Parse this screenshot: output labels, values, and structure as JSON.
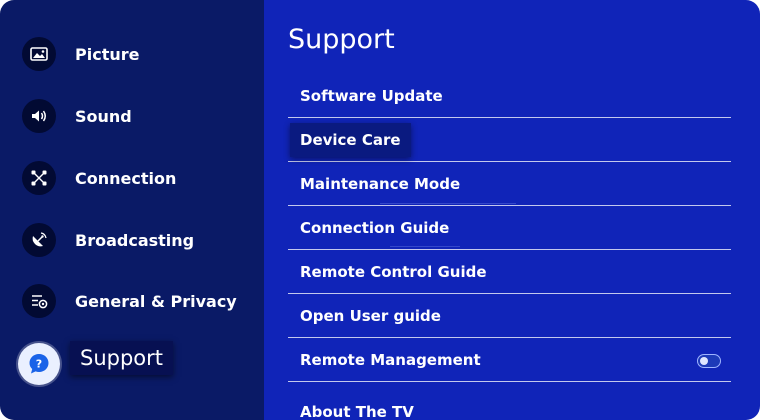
{
  "sidebar": {
    "items": [
      {
        "label": "Picture",
        "icon": "picture-icon"
      },
      {
        "label": "Sound",
        "icon": "speaker-icon"
      },
      {
        "label": "Connection",
        "icon": "network-icon"
      },
      {
        "label": "Broadcasting",
        "icon": "satellite-dish-icon"
      },
      {
        "label": "General & Privacy",
        "icon": "settings-list-icon"
      },
      {
        "label": "Support",
        "icon": "help-chat-icon",
        "active": true
      }
    ]
  },
  "main": {
    "title": "Support",
    "items": [
      {
        "label": "Software Update"
      },
      {
        "label": "Device Care",
        "focused": true
      },
      {
        "label": "Maintenance Mode"
      },
      {
        "label": "Connection Guide"
      },
      {
        "label": "Remote Control Guide"
      },
      {
        "label": "Open User guide"
      },
      {
        "label": "Remote Management",
        "toggle": "off"
      },
      {
        "label": "About The TV"
      }
    ]
  },
  "colors": {
    "sidebar_bg": "#0a1a66",
    "main_bg": "#1024b8",
    "focus_bg": "#0a1a80"
  }
}
